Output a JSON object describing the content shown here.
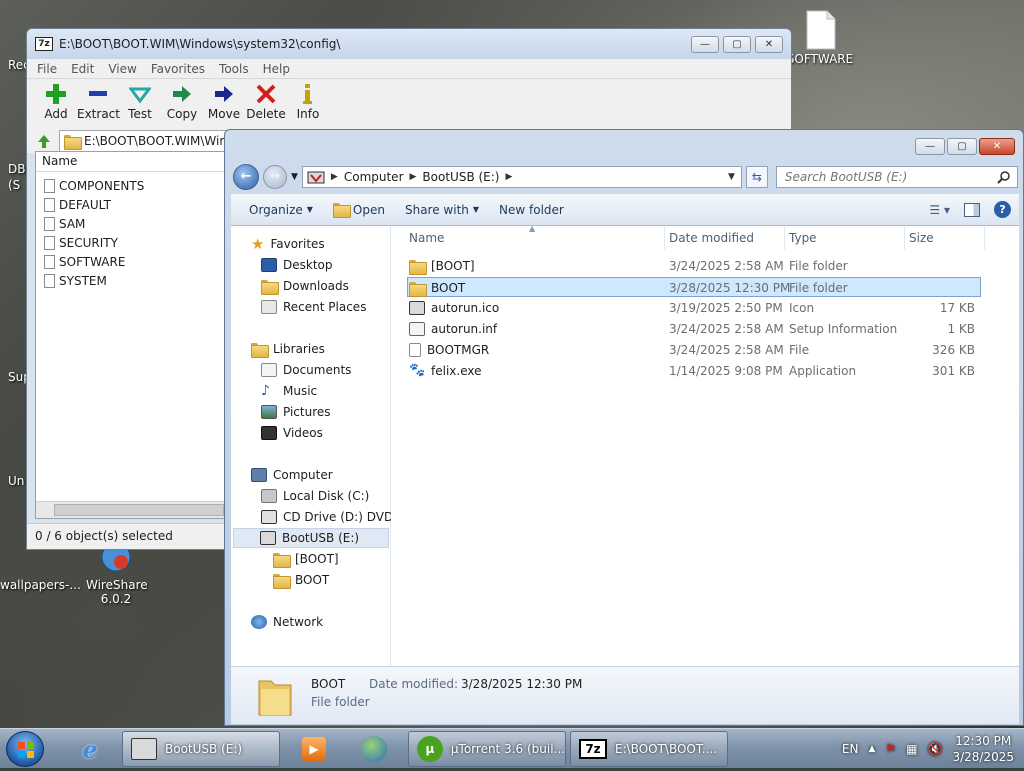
{
  "desktop": {
    "icons": [
      {
        "label": "SOFTWARE",
        "name": "desktop-icon-software"
      },
      {
        "label": "wallpapers-...",
        "name": "desktop-icon-wallpapers"
      },
      {
        "label": "WireShare 6.0.2",
        "name": "desktop-icon-wireshare"
      }
    ],
    "edge_labels": [
      "Rec",
      "DB",
      "(S",
      "Sup",
      "Un"
    ]
  },
  "zip_window": {
    "title": "E:\\BOOT\\BOOT.WIM\\Windows\\system32\\config\\",
    "app_badge": "7z",
    "menu": [
      "File",
      "Edit",
      "View",
      "Favorites",
      "Tools",
      "Help"
    ],
    "toolbar": [
      {
        "label": "Add",
        "icon": "plus-icon",
        "color": "#22a022"
      },
      {
        "label": "Extract",
        "icon": "minus-icon",
        "color": "#1f3fb0"
      },
      {
        "label": "Test",
        "icon": "check-icon",
        "color": "#2aa6a6"
      },
      {
        "label": "Copy",
        "icon": "copy-arrow-icon",
        "color": "#1f8a4e"
      },
      {
        "label": "Move",
        "icon": "move-arrow-icon",
        "color": "#1a2a8c"
      },
      {
        "label": "Delete",
        "icon": "delete-x-icon",
        "color": "#d0201c"
      },
      {
        "label": "Info",
        "icon": "info-icon",
        "color": "#c8a000"
      }
    ],
    "address": "E:\\BOOT\\BOOT.WIM\\Wir",
    "column_name": "Name",
    "files": [
      "COMPONENTS",
      "DEFAULT",
      "SAM",
      "SECURITY",
      "SOFTWARE",
      "SYSTEM"
    ],
    "status": "0 / 6 object(s) selected"
  },
  "explorer": {
    "breadcrumb": [
      "Computer",
      "BootUSB (E:)"
    ],
    "search_placeholder": "Search BootUSB (E:)",
    "commands": {
      "organize": "Organize",
      "open": "Open",
      "share_with": "Share with",
      "new_folder": "New folder"
    },
    "nav": {
      "favorites": "Favorites",
      "favorites_items": [
        "Desktop",
        "Downloads",
        "Recent Places"
      ],
      "libraries": "Libraries",
      "libraries_items": [
        "Documents",
        "Music",
        "Pictures",
        "Videos"
      ],
      "computer": "Computer",
      "computer_items": [
        "Local Disk (C:)",
        "CD Drive (D:) DVD1",
        "BootUSB (E:)"
      ],
      "bootusb_children": [
        "[BOOT]",
        "BOOT"
      ],
      "network": "Network"
    },
    "columns": {
      "name": "Name",
      "date": "Date modified",
      "type": "Type",
      "size": "Size"
    },
    "files": [
      {
        "name": "[BOOT]",
        "date": "3/24/2025 2:58 AM",
        "type": "File folder",
        "size": "",
        "icon": "folder-icon",
        "selected": false
      },
      {
        "name": "BOOT",
        "date": "3/28/2025 12:30 PM",
        "type": "File folder",
        "size": "",
        "icon": "folder-icon",
        "selected": true
      },
      {
        "name": "autorun.ico",
        "date": "3/19/2025 2:50 PM",
        "type": "Icon",
        "size": "17 KB",
        "icon": "ico-file-icon",
        "selected": false
      },
      {
        "name": "autorun.inf",
        "date": "3/24/2025 2:58 AM",
        "type": "Setup Information",
        "size": "1 KB",
        "icon": "inf-file-icon",
        "selected": false
      },
      {
        "name": "BOOTMGR",
        "date": "3/24/2025 2:58 AM",
        "type": "File",
        "size": "326 KB",
        "icon": "blank-file-icon",
        "selected": false
      },
      {
        "name": "felix.exe",
        "date": "1/14/2025 9:08 PM",
        "type": "Application",
        "size": "301 KB",
        "icon": "paw-exe-icon",
        "selected": false
      }
    ],
    "details": {
      "name": "BOOT",
      "date_label": "Date modified:",
      "date_value": "3/28/2025 12:30 PM",
      "type": "File folder"
    }
  },
  "taskbar": {
    "buttons": [
      {
        "label": "BootUSB (E:)",
        "name": "taskbar-explorer-button"
      },
      {
        "label": "µTorrent 3.6  (buil...",
        "name": "taskbar-utorrent-button"
      },
      {
        "label": "E:\\BOOT\\BOOT....",
        "name": "taskbar-7zip-button"
      }
    ],
    "language": "EN",
    "time": "12:30 PM",
    "date": "3/28/2025"
  },
  "colors": {
    "selection": "#cde8ff",
    "selection_border": "#7da2ce",
    "column_header_text": "#4c607a",
    "secondary_text": "#6d6d6d"
  }
}
